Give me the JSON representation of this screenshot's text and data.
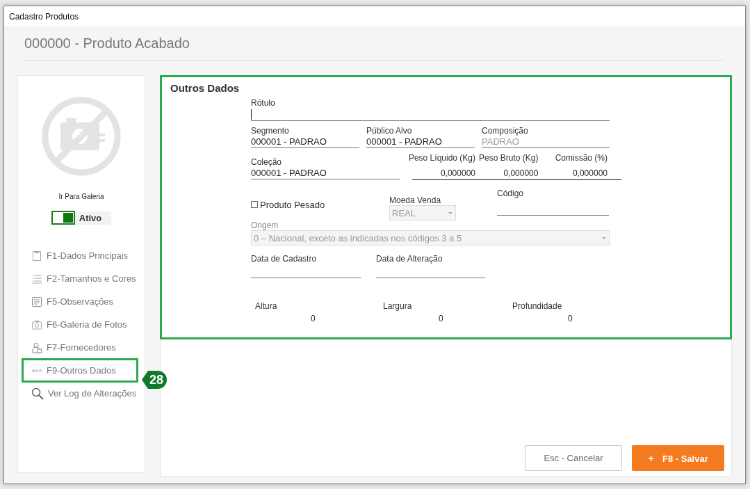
{
  "window": {
    "title": "Cadastro Produtos"
  },
  "header": {
    "title": "000000 - Produto Acabado"
  },
  "sidebar": {
    "gallery_link": "Ir Para Galeria",
    "status_toggle": {
      "label": "Ativo",
      "on": true
    },
    "items": [
      {
        "kind": "document",
        "label": "F1-Dados Principais",
        "selected": false
      },
      {
        "kind": "list",
        "label": "F2-Tamanhos  e Cores",
        "selected": false
      },
      {
        "kind": "note",
        "label": "F5-Observações",
        "selected": false
      },
      {
        "kind": "camera",
        "label": "F6-Galeria de Fotos",
        "selected": false
      },
      {
        "kind": "person",
        "label": "F7-Fornecedores",
        "selected": false
      },
      {
        "kind": "dots",
        "label": "F9-Outros Dados",
        "selected": true
      },
      {
        "kind": "search",
        "label": "Ver Log de Alterações",
        "selected": false
      }
    ]
  },
  "callout": {
    "number": "28"
  },
  "section": {
    "title": "Outros Dados",
    "rotulo": {
      "label": "Rótulo"
    },
    "segmento": {
      "label": "Segmento",
      "value": "000001 - PADRAO"
    },
    "publico_alvo": {
      "label": "Público Alvo",
      "value": "000001 - PADRAO"
    },
    "composicao": {
      "label": "Composição",
      "value": "PADRAO",
      "disabled": true
    },
    "colecao": {
      "label": "Coleção",
      "value": "000001 - PADRAO"
    },
    "pesos": [
      {
        "label": "Peso Líquido (Kg)",
        "value": "0,000000"
      },
      {
        "label": "Peso Bruto (Kg)",
        "value": "0,000000"
      },
      {
        "label": "Comissão (%)",
        "value": "0,000000"
      }
    ],
    "produto_pesado": {
      "label": "Produto Pesado",
      "checked": false
    },
    "moeda_venda": {
      "label": "Moeda Venda",
      "value": "REAL",
      "disabled": true
    },
    "codigo": {
      "label": "Código"
    },
    "origem": {
      "label": "Origem",
      "value": "0 – Nacional, exceto as indicadas nos códigos 3 a 5",
      "disabled": true
    },
    "data_cadastro": {
      "label": "Data de Cadastro"
    },
    "data_alteracao": {
      "label": "Data de Alteração"
    },
    "dimensoes": [
      {
        "label": "Altura",
        "value": "0"
      },
      {
        "label": "Largura",
        "value": "0"
      },
      {
        "label": "Profundidade",
        "value": "0"
      }
    ]
  },
  "buttons": {
    "cancel": "Esc - Cancelar",
    "save_icon": "+",
    "save": "F8 - Salvar"
  }
}
